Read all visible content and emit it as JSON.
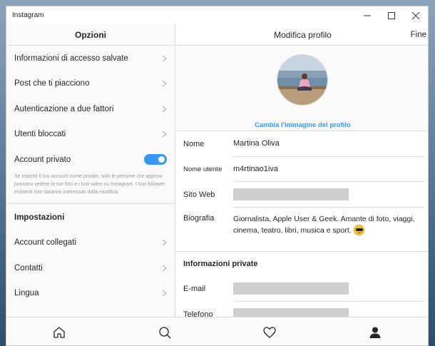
{
  "window": {
    "title": "Instagram"
  },
  "left_panel": {
    "header": "Opzioni",
    "items": [
      {
        "label": "Informazioni di accesso salvate"
      },
      {
        "label": "Post che ti piacciono"
      },
      {
        "label": "Autenticazione a due fattori"
      },
      {
        "label": "Utenti bloccati"
      }
    ],
    "private_account": {
      "label": "Account privato",
      "enabled": true,
      "note": "Se imposti il tuo account come privato, solo le persone che approvi possono vedere le tue foto e i tuoi video su Instagram. I tuoi follower esistenti non saranno interessati dalla modifica."
    },
    "settings_title": "Impostazioni",
    "settings_items": [
      {
        "label": "Account collegati"
      },
      {
        "label": "Contatti"
      },
      {
        "label": "Lingua"
      }
    ]
  },
  "right_panel": {
    "header": "Modifica profilo",
    "done_label": "Fine",
    "change_photo_label": "Cambia l'immagine del profilo",
    "fields": {
      "name_label": "Nome",
      "name_value": "Martina Oliva",
      "username_label": "Nome utente",
      "username_value": "m4rtinao1iva",
      "website_label": "Sito Web",
      "bio_label": "Biografia",
      "bio_value": "Giornalista, Apple User & Geek. Amante di foto, viaggi, cinema, teatro, libri, musica e sport."
    },
    "private_info": {
      "title": "Informazioni private",
      "email_label": "E-mail",
      "phone_label": "Telefono"
    }
  },
  "colors": {
    "accent": "#3897f0",
    "border": "#dbdbdb",
    "muted": "#999999"
  },
  "icons": {
    "tabs": [
      "home-icon",
      "search-icon",
      "heart-icon",
      "profile-icon"
    ]
  }
}
